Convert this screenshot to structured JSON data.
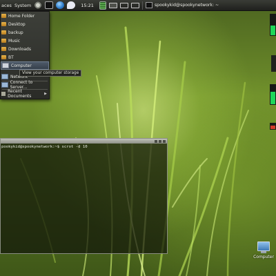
{
  "panel": {
    "menus": [
      "aces",
      "System"
    ],
    "clock": "15:21",
    "terminal_task_title": "spookykid@spookynetwork: ~"
  },
  "places_menu": {
    "items": [
      {
        "label": "Home Folder",
        "icon": "folder-icon"
      },
      {
        "label": "Desktop",
        "icon": "folder-icon"
      },
      {
        "label": "backup",
        "icon": "folder-icon"
      },
      {
        "label": "Music",
        "icon": "folder-icon"
      },
      {
        "label": "Downloads",
        "icon": "folder-icon"
      },
      {
        "label": "BT",
        "icon": "folder-icon"
      },
      {
        "label": "Computer",
        "icon": "computer-icon"
      },
      {
        "label": "Network",
        "icon": "network-icon"
      },
      {
        "label": "Connect to Server...",
        "icon": "network-icon"
      },
      {
        "label": "Recent Documents",
        "icon": "recent-icon"
      }
    ],
    "tooltip": "View your computer storage"
  },
  "terminal": {
    "prompt_line": "pookykid@spookynetwork:~$ scrot -d 10"
  },
  "desktop": {
    "icons": [
      {
        "label": "Computer"
      }
    ]
  },
  "colors": {
    "panel_bg": "#2b2c28",
    "menu_highlight": "#45515e",
    "gauge_green": "#1fd65a",
    "gauge_red": "#d23a2a"
  }
}
